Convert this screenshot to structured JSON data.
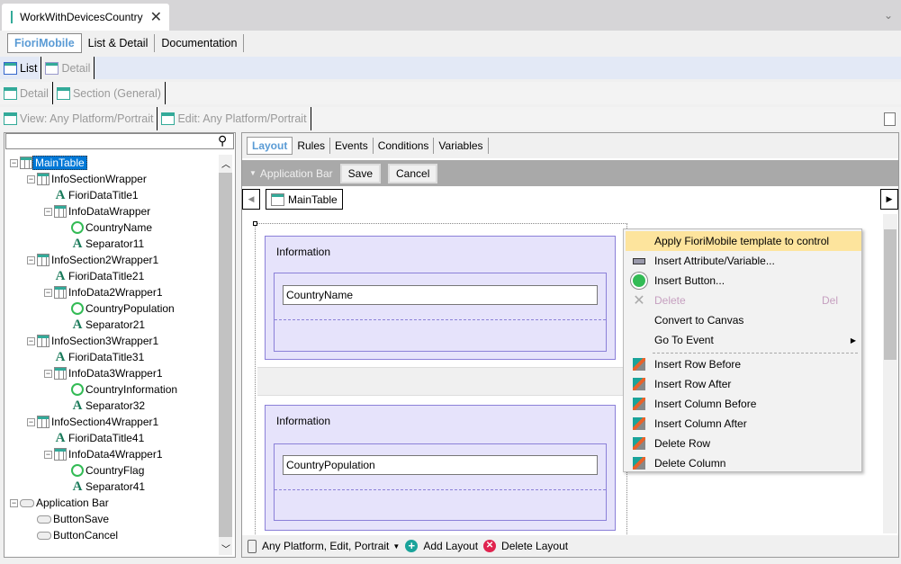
{
  "document_tab": {
    "title": "WorkWithDevicesCountry"
  },
  "pattern_tabs": [
    {
      "label": "FioriMobile",
      "selected": true
    },
    {
      "label": "List & Detail"
    },
    {
      "label": "Documentation"
    }
  ],
  "level_tabs": [
    {
      "label": "List",
      "selected": true
    },
    {
      "label": "Detail"
    }
  ],
  "section_tabs": [
    {
      "label": "Detail"
    },
    {
      "label": "Section (General)"
    }
  ],
  "layout_tabs": [
    {
      "label": "View: Any Platform/Portrait"
    },
    {
      "label": "Edit: Any Platform/Portrait"
    }
  ],
  "search": {
    "value": ""
  },
  "tree": [
    {
      "label": "MainTable",
      "level": 0,
      "icon": "table",
      "selected": true
    },
    {
      "label": "InfoSectionWrapper",
      "level": 1,
      "icon": "table"
    },
    {
      "label": "FioriDataTitle1",
      "level": 2,
      "icon": "text"
    },
    {
      "label": "InfoDataWrapper",
      "level": 2,
      "icon": "table"
    },
    {
      "label": "CountryName",
      "level": 3,
      "icon": "attribute"
    },
    {
      "label": "Separator11",
      "level": 3,
      "icon": "text"
    },
    {
      "label": "InfoSection2Wrapper1",
      "level": 1,
      "icon": "table"
    },
    {
      "label": "FioriDataTitle21",
      "level": 2,
      "icon": "text"
    },
    {
      "label": "InfoData2Wrapper1",
      "level": 2,
      "icon": "table"
    },
    {
      "label": "CountryPopulation",
      "level": 3,
      "icon": "attribute"
    },
    {
      "label": "Separator21",
      "level": 3,
      "icon": "text"
    },
    {
      "label": "InfoSection3Wrapper1",
      "level": 1,
      "icon": "table"
    },
    {
      "label": "FioriDataTitle31",
      "level": 2,
      "icon": "text"
    },
    {
      "label": "InfoData3Wrapper1",
      "level": 2,
      "icon": "table"
    },
    {
      "label": "CountryInformation",
      "level": 3,
      "icon": "attribute"
    },
    {
      "label": "Separator32",
      "level": 3,
      "icon": "text"
    },
    {
      "label": "InfoSection4Wrapper1",
      "level": 1,
      "icon": "table"
    },
    {
      "label": "FioriDataTitle41",
      "level": 2,
      "icon": "text"
    },
    {
      "label": "InfoData4Wrapper1",
      "level": 2,
      "icon": "table"
    },
    {
      "label": "CountryFlag",
      "level": 3,
      "icon": "attribute"
    },
    {
      "label": "Separator41",
      "level": 3,
      "icon": "text"
    },
    {
      "label": "Application Bar",
      "level": 0,
      "icon": "button-group"
    },
    {
      "label": "ButtonSave",
      "level": 1,
      "icon": "button"
    },
    {
      "label": "ButtonCancel",
      "level": 1,
      "icon": "button"
    }
  ],
  "editor_tabs": [
    {
      "label": "Layout",
      "selected": true
    },
    {
      "label": "Rules"
    },
    {
      "label": "Events"
    },
    {
      "label": "Conditions"
    },
    {
      "label": "Variables"
    }
  ],
  "app_bar": {
    "label": "Application Bar",
    "buttons": [
      "Save",
      "Cancel"
    ]
  },
  "breadcrumb": {
    "label": "MainTable"
  },
  "canvas": {
    "sections": [
      {
        "title": "Information",
        "field": "CountryName"
      },
      {
        "title": "Information",
        "field": "CountryPopulation"
      }
    ]
  },
  "context_menu": {
    "items": [
      {
        "label": "Apply FioriMobile template to control",
        "highlighted": true,
        "icon": ""
      },
      {
        "label": "Insert Attribute/Variable...",
        "icon": "attribute-icon"
      },
      {
        "label": "Insert Button...",
        "icon": "button-icon"
      },
      {
        "label": "Delete",
        "shortcut": "Del",
        "disabled": true,
        "icon": "delete-icon"
      },
      {
        "label": "Convert to Canvas",
        "icon": ""
      },
      {
        "label": "Go To Event",
        "submenu": true,
        "icon": ""
      },
      {
        "label": "Insert Row Before",
        "icon": "insert-row-before-icon"
      },
      {
        "label": "Insert Row After",
        "icon": "insert-row-after-icon"
      },
      {
        "label": "Insert Column Before",
        "icon": "insert-column-before-icon"
      },
      {
        "label": "Insert Column After",
        "icon": "insert-column-after-icon"
      },
      {
        "label": "Delete Row",
        "icon": "delete-row-icon"
      },
      {
        "label": "Delete Column",
        "icon": "delete-column-icon"
      }
    ]
  },
  "bottom_bar": {
    "platform": "Any Platform, Edit, Portrait",
    "add_layout": "Add Layout",
    "delete_layout": "Delete Layout"
  },
  "colors": {
    "accent": "#5a9bd5",
    "selection": "#0078d7",
    "section_fill": "#e6e3fb",
    "section_border": "#8b80d8",
    "menu_highlight": "#fde49d",
    "add": "#1aa39a",
    "delete": "#e0234e"
  }
}
